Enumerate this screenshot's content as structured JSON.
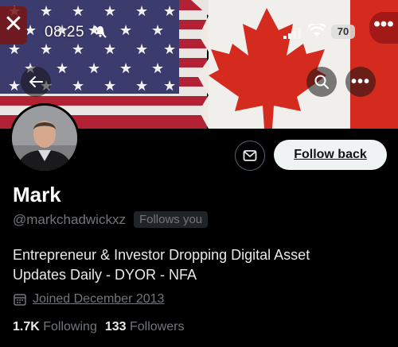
{
  "status": {
    "time": "08:25",
    "battery": "70"
  },
  "profile": {
    "name": "Mark",
    "handle": "@markchadwickxz",
    "follows_you": "Follows you",
    "bio_line1": "Entrepreneur & Investor Dropping Digital Asset",
    "bio_line2": "Updates Daily - DYOR - NFA",
    "joined": "Joined December 2013",
    "following_count": "1.7K",
    "following_label": "Following",
    "followers_count": "133",
    "followers_label": "Followers"
  },
  "actions": {
    "follow_back": "Follow back"
  },
  "icons": {
    "close": "close-icon",
    "back": "arrow-left-icon",
    "search": "search-icon",
    "more": "more-horizontal-icon",
    "message": "envelope-icon",
    "calendar": "calendar-icon"
  },
  "colors": {
    "background": "#000000",
    "follow_button_bg": "#eff3f4",
    "secondary_text": "#71767b",
    "canada_red": "#d52b1e",
    "usa_blue": "#3c3b6e",
    "usa_red": "#b22234"
  }
}
